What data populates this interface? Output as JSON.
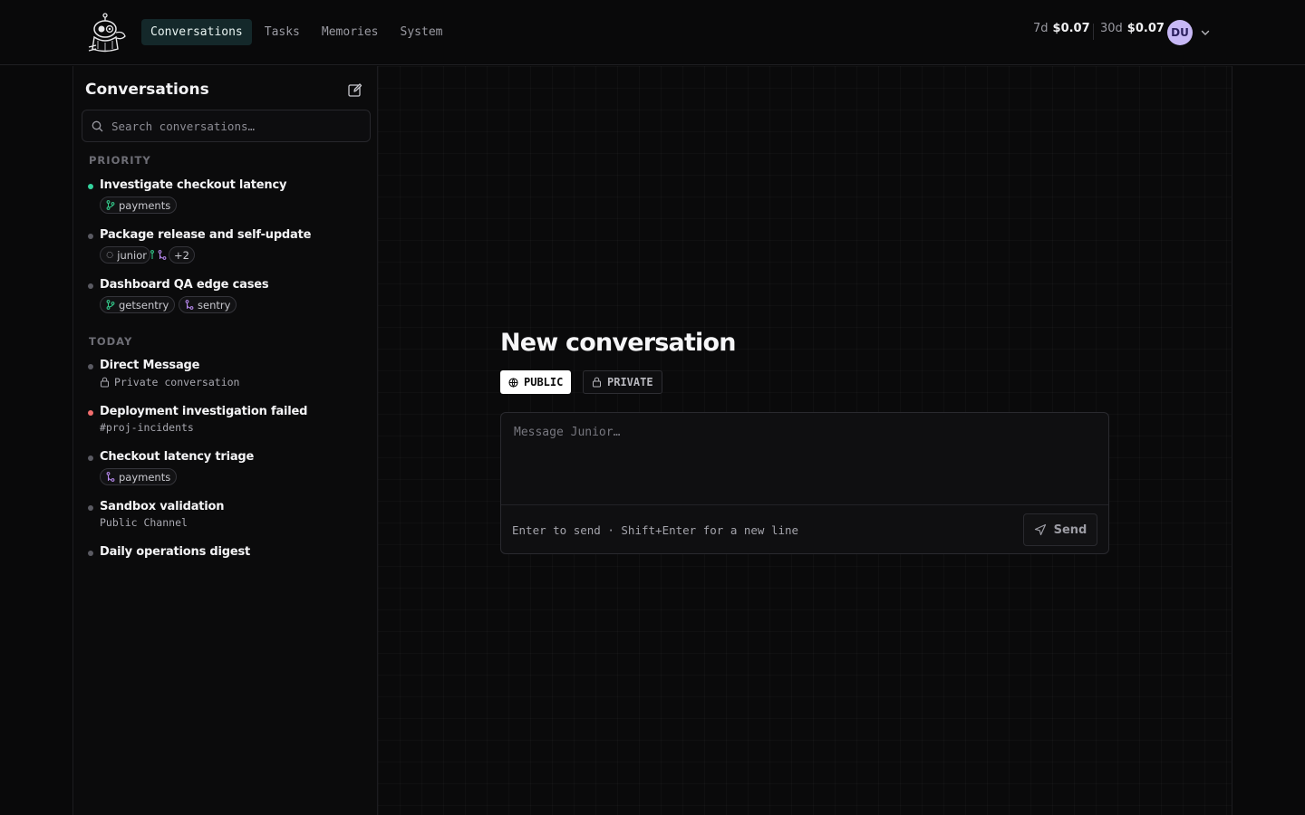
{
  "nav": {
    "items": [
      "Conversations",
      "Tasks",
      "Memories",
      "System"
    ],
    "active_index": 0
  },
  "costs": {
    "week_label": "7d",
    "week_value": "$0.07",
    "month_label": "30d",
    "month_value": "$0.07"
  },
  "user": {
    "initials": "DU"
  },
  "sidebar": {
    "title": "Conversations",
    "search_placeholder": "Search conversations…",
    "sections": {
      "priority": "PRIORITY",
      "today": "TODAY"
    },
    "conversations": [
      {
        "title": "Investigate checkout latency",
        "tags": [
          "payments"
        ],
        "status": "active"
      },
      {
        "title": "Package release and self-update",
        "tags": [
          "junior",
          "+2"
        ],
        "status": "idle"
      },
      {
        "title": "Dashboard QA edge cases",
        "tags": [
          "getsentry",
          "sentry"
        ],
        "status": "idle"
      },
      {
        "title": "Direct Message",
        "subtitle": "Private conversation",
        "status": "idle"
      },
      {
        "title": "Deployment investigation failed",
        "subtitle": "#proj-incidents",
        "status": "error"
      },
      {
        "title": "Checkout latency triage",
        "tags": [
          "payments"
        ],
        "status": "idle"
      },
      {
        "title": "Sandbox validation",
        "subtitle": "Public Channel",
        "status": "idle"
      },
      {
        "title": "Daily operations digest",
        "status": "idle"
      }
    ]
  },
  "composer": {
    "title": "New conversation",
    "visibility": {
      "public": "PUBLIC",
      "private": "PRIVATE",
      "selected": "public"
    },
    "placeholder": "Message Junior…",
    "hint": "Enter to send · Shift+Enter for a new line",
    "send_label": "Send"
  },
  "colors": {
    "active_dot": "#34d39e",
    "error_dot": "#f26d6d",
    "idle_dot": "#5a5a62",
    "accent_nav": "#14282a",
    "avatar_bg": "#c7b8f5"
  },
  "icons": {
    "logo": "robot-mascot-logo",
    "new_chat": "edit-icon",
    "search": "search-icon",
    "git_branch": "git-branch-icon",
    "git_merge": "git-merge-icon",
    "loader": "loader-icon",
    "lock": "lock-icon",
    "globe": "globe-icon",
    "send": "send-icon",
    "chevron": "chevron-down-icon"
  }
}
